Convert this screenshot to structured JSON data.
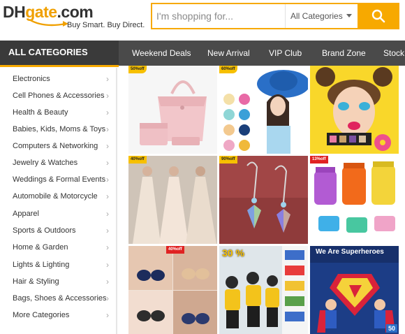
{
  "header": {
    "logo": {
      "dh": "DH",
      "gate": "gate",
      "com": ".com",
      "tagline": "Buy Smart. Buy Direct."
    },
    "search": {
      "placeholder": "I'm shopping for...",
      "category": "All Categories"
    }
  },
  "nav": {
    "all_categories": "ALL CATEGORIES",
    "links": [
      "Weekend Deals",
      "New Arrival",
      "VIP Club",
      "Brand Zone",
      "Stock"
    ]
  },
  "sidebar": {
    "categories": [
      "Electronics",
      "Cell Phones & Accessories",
      "Health & Beauty",
      "Babies, Kids, Moms & Toys",
      "Computers & Networking",
      "Jewelry & Watches",
      "Weddings & Formal Events",
      "Automobile & Motorcycle",
      "Apparel",
      "Sports & Outdoors",
      "Home & Garden",
      "Lights & Lighting",
      "Hair & Styling",
      "Bags, Shoes & Accessories",
      "More Categories"
    ]
  },
  "products": [
    {
      "name": "pink-handbag-set",
      "badge": "50%off"
    },
    {
      "name": "sun-hat-model",
      "badge": "60%off"
    },
    {
      "name": "makeup-model",
      "badge": ""
    },
    {
      "name": "wedding-dresses",
      "badge": "40%off"
    },
    {
      "name": "crystal-earrings",
      "badge": "90%off"
    },
    {
      "name": "dry-bags",
      "badge": "13%off"
    },
    {
      "name": "lingerie",
      "badge": "40%off"
    },
    {
      "name": "school-backpacks",
      "badge": "30 %"
    },
    {
      "name": "superhero-kids",
      "badge": "",
      "headline": "We Are Superheroes",
      "corner": "50"
    }
  ],
  "colors": {
    "accent": "#f7a900",
    "nav_bg": "#4a4a4a",
    "allcat_bg": "#3a3a3a"
  }
}
